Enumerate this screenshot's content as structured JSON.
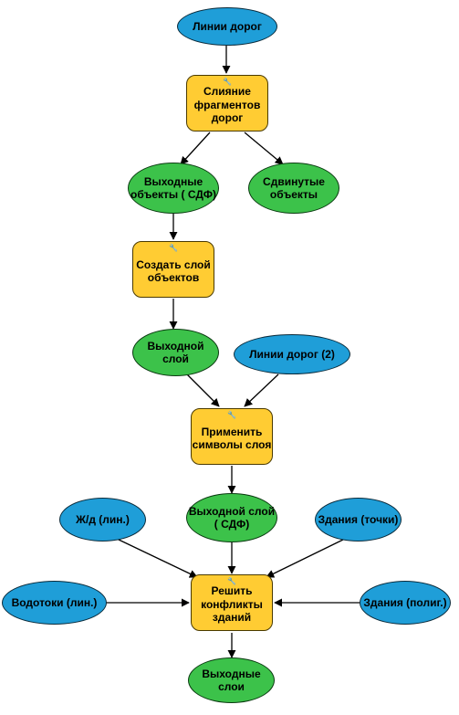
{
  "nodes": {
    "n1": "Линии дорог",
    "n2": "Слияние фрагментов дорог",
    "n3": "Выходные объекты ( СДФ)",
    "n4": "Сдвинутые объекты",
    "n5": "Создать слой объектов",
    "n6": "Выходной слой",
    "n7": "Линии дорог (2)",
    "n8": "Применить символы слоя",
    "n9": "Выходной слой ( СДФ)",
    "n10": "Ж/д (лин.)",
    "n11": "Здания (точки)",
    "n12": "Водотоки (лин.)",
    "n13": "Здания (полиг.)",
    "n14": "Решить конфликты зданий",
    "n15": "Выходные слои"
  }
}
